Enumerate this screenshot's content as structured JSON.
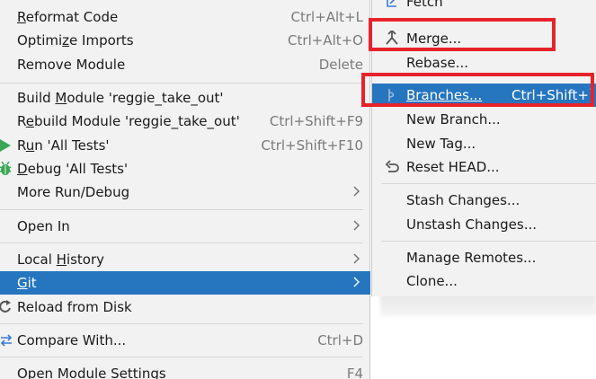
{
  "left_menu": {
    "items": [
      {
        "id": "reformat",
        "pre": "",
        "u": "R",
        "post": "eformat Code",
        "shortcut": "Ctrl+Alt+L"
      },
      {
        "id": "optimize",
        "pre": "Optimi",
        "u": "z",
        "post": "e Imports",
        "shortcut": "Ctrl+Alt+O"
      },
      {
        "id": "remove",
        "pre": "Remove Module",
        "u": "",
        "post": "",
        "shortcut": "Delete"
      },
      {
        "id": "build",
        "pre": "Build ",
        "u": "M",
        "post": "odule 'reggie_take_out'",
        "shortcut": ""
      },
      {
        "id": "rebuild",
        "pre": "R",
        "u": "e",
        "post": "build Module 'reggie_take_out'",
        "shortcut": "Ctrl+Shift+F9"
      },
      {
        "id": "run",
        "pre": "R",
        "u": "u",
        "post": "n 'All Tests'",
        "shortcut": "Ctrl+Shift+F10"
      },
      {
        "id": "debug",
        "pre": "",
        "u": "D",
        "post": "ebug 'All Tests'",
        "shortcut": ""
      },
      {
        "id": "more-run",
        "pre": "More Run/Debug",
        "u": "",
        "post": "",
        "shortcut": ""
      },
      {
        "id": "open-in",
        "pre": "Open In",
        "u": "",
        "post": "",
        "shortcut": ""
      },
      {
        "id": "local-history",
        "pre": "Local ",
        "u": "H",
        "post": "istory",
        "shortcut": ""
      },
      {
        "id": "git",
        "pre": "",
        "u": "G",
        "post": "it",
        "shortcut": ""
      },
      {
        "id": "reload",
        "pre": "Reload from Disk",
        "u": "",
        "post": "",
        "shortcut": ""
      },
      {
        "id": "compare",
        "pre": "Compare With...",
        "u": "",
        "post": "",
        "shortcut": "Ctrl+D"
      },
      {
        "id": "open-settings",
        "pre": "Open Module Settings",
        "u": "",
        "post": "",
        "shortcut": "F4"
      }
    ]
  },
  "right_menu": {
    "items": [
      {
        "id": "fetch",
        "label": "Fetch",
        "shortcut": ""
      },
      {
        "id": "merge",
        "label": "Merge...",
        "shortcut": ""
      },
      {
        "id": "rebase",
        "label": "Rebase...",
        "shortcut": ""
      },
      {
        "id": "branches",
        "label": "Branches...",
        "shortcut": "Ctrl+Shift+`"
      },
      {
        "id": "new-branch",
        "label": "New Branch...",
        "shortcut": ""
      },
      {
        "id": "new-tag",
        "label": "New Tag...",
        "shortcut": ""
      },
      {
        "id": "reset-head",
        "label": "Reset HEAD...",
        "shortcut": ""
      },
      {
        "id": "stash",
        "label": "Stash Changes...",
        "shortcut": ""
      },
      {
        "id": "unstash",
        "label": "Unstash Changes...",
        "shortcut": ""
      },
      {
        "id": "remotes",
        "label": "Manage Remotes...",
        "shortcut": ""
      },
      {
        "id": "clone",
        "label": "Clone...",
        "shortcut": ""
      }
    ]
  },
  "colors": {
    "selection": "#2675bf",
    "annotation": "#e8222b",
    "run_icon": "#3aa655",
    "debug_icon": "#3aa655"
  },
  "icons": {
    "run": "play-icon",
    "debug": "bug-icon",
    "reload": "reload-icon",
    "compare": "compare-arrows-icon",
    "fetch": "fetch-icon",
    "merge": "merge-icon",
    "branches": "branch-icon",
    "reset": "undo-icon",
    "submenu": "chevron-right-icon"
  }
}
